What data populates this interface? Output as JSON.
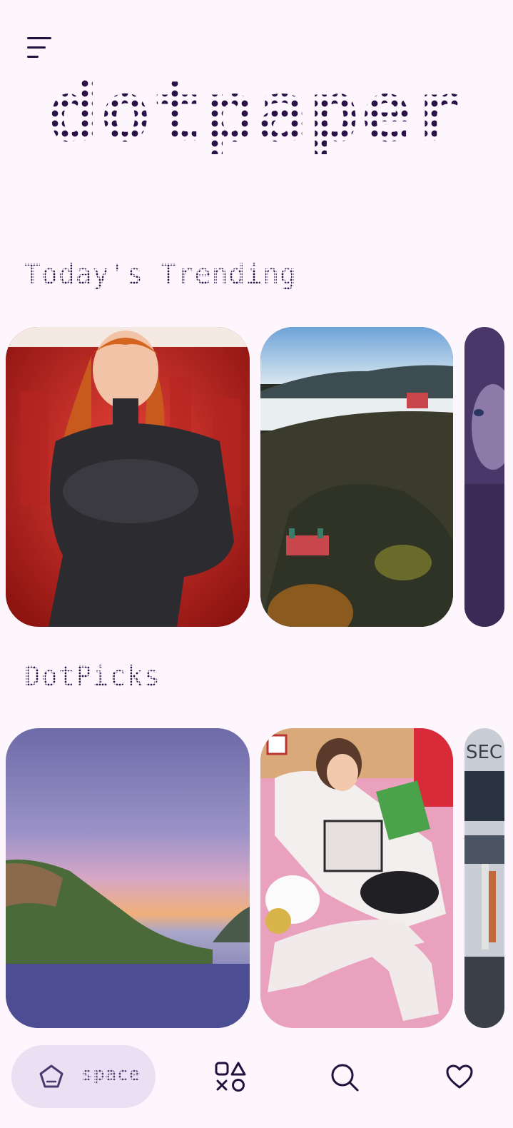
{
  "app": {
    "logo_text": "dotpaper",
    "menu_icon": "menu-lines-icon"
  },
  "sections": [
    {
      "title": "Today's Trending",
      "cards": [
        {
          "alt": "wallpaper-anime-woman-red",
          "theme": "red"
        },
        {
          "alt": "wallpaper-church-hill-fog",
          "theme": "landscape"
        },
        {
          "alt": "wallpaper-anime-purple",
          "theme": "purple"
        }
      ]
    },
    {
      "title": "DotPicks",
      "cards": [
        {
          "alt": "wallpaper-coast-sunset",
          "theme": "sunset"
        },
        {
          "alt": "wallpaper-anime-bedroom",
          "theme": "pink"
        },
        {
          "alt": "wallpaper-space-station",
          "theme": "space"
        }
      ]
    }
  ],
  "bottom_nav": {
    "active": "space",
    "items": [
      {
        "label": "space",
        "icon": "pentagon-icon"
      },
      {
        "label": "",
        "icon": "shapes-icon"
      },
      {
        "label": "",
        "icon": "search-icon"
      },
      {
        "label": "",
        "icon": "heart-icon"
      }
    ]
  },
  "colors": {
    "background": "#fdf6fc",
    "ink": "#24103f",
    "pill": "#ebe0f3"
  }
}
